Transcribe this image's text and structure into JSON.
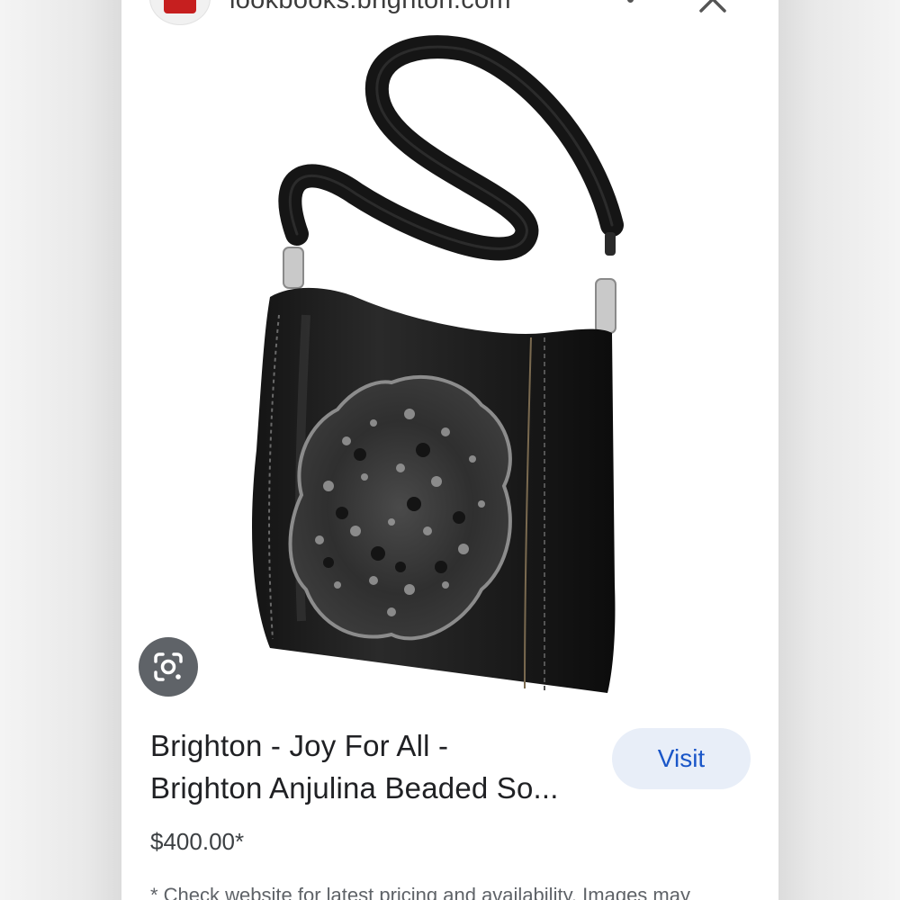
{
  "header": {
    "source_domain": "lookbooks.brighton.com",
    "favicon_color": "#c61f1f",
    "icons": [
      "more-options-icon",
      "close-icon"
    ]
  },
  "image": {
    "subject": "black leather crossbody bag with beaded medallion",
    "lens_icon": "google-lens-icon"
  },
  "product": {
    "title_line1": "Brighton - Joy For All -",
    "title_line2": "Brighton Anjulina Beaded So...",
    "price": "$400.00*",
    "visit_label": "Visit",
    "disclaimer": "* Check website for latest pricing and availability. Images may"
  },
  "colors": {
    "accent": "#1a56c8",
    "visit_bg": "#e8eef8",
    "lens_bg": "#5f6368"
  }
}
